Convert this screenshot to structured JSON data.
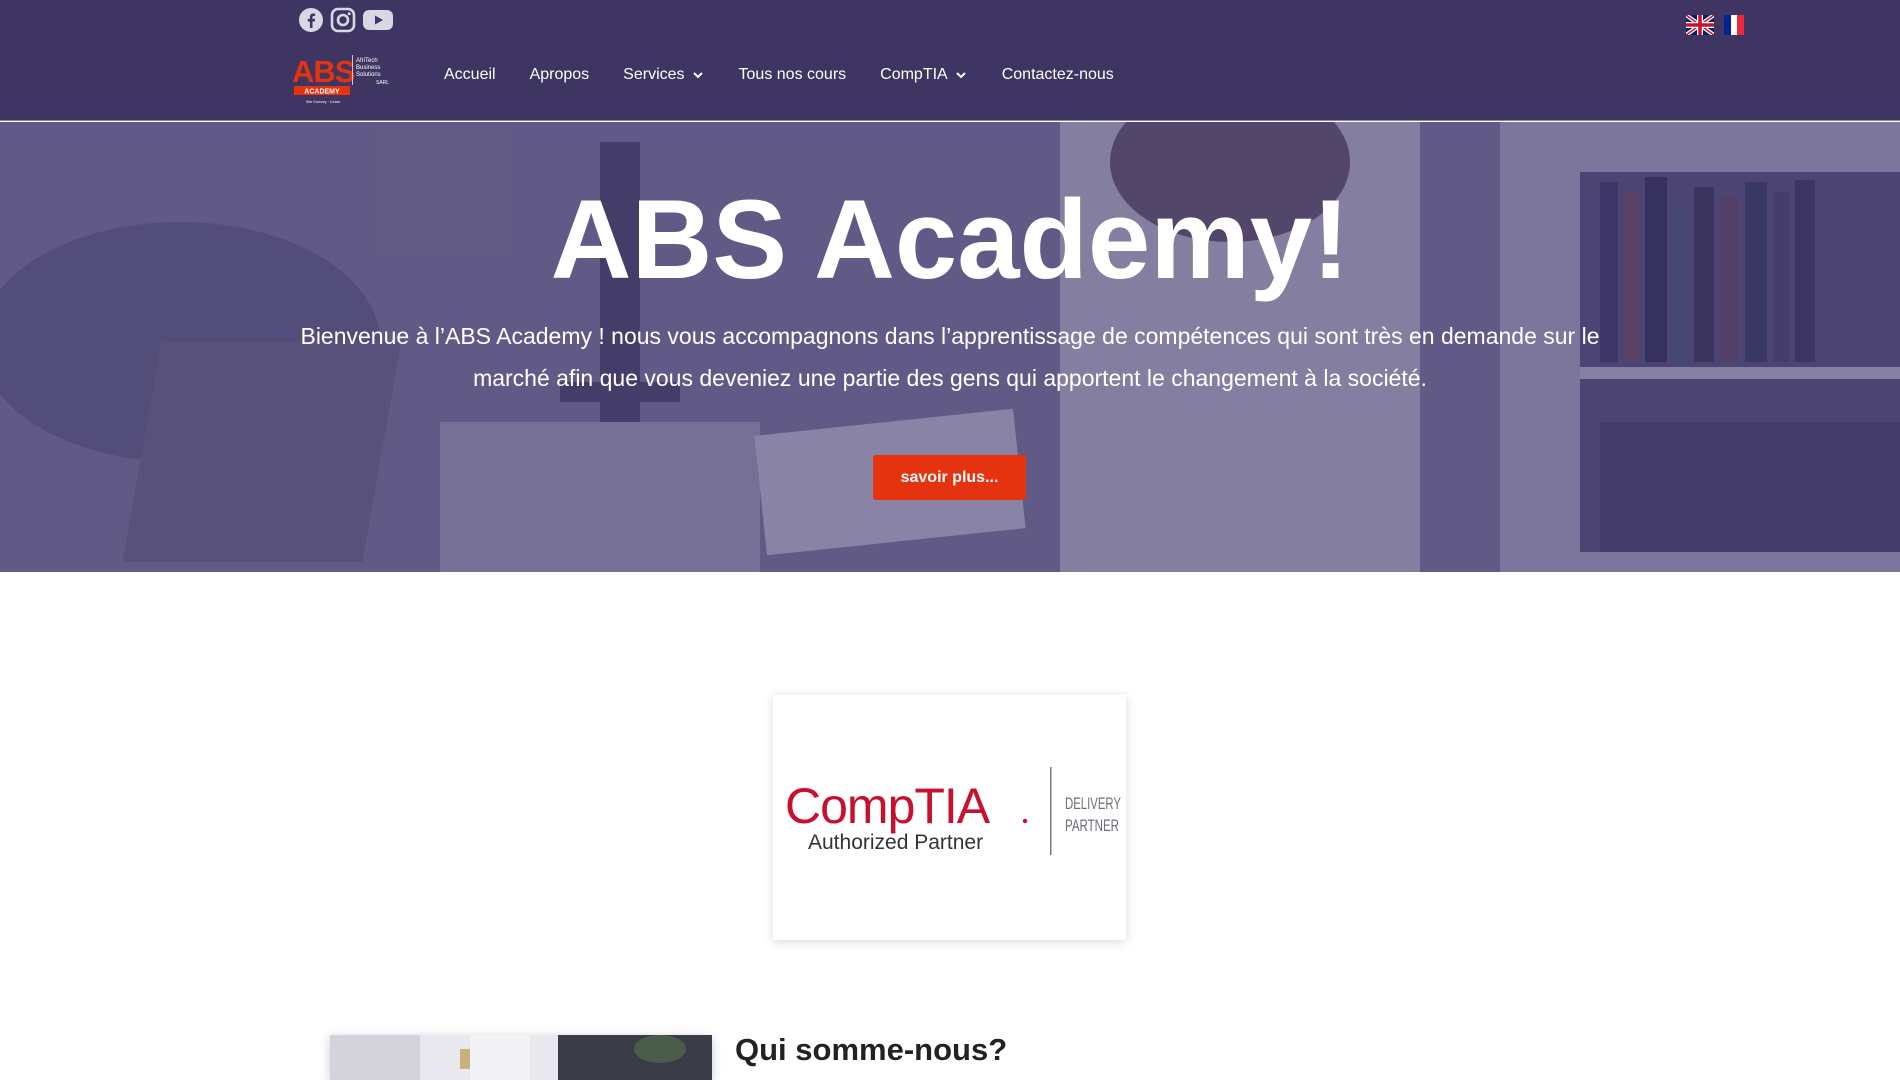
{
  "header": {
    "social": [
      {
        "name": "facebook-icon"
      },
      {
        "name": "instagram-icon"
      },
      {
        "name": "youtube-icon"
      }
    ],
    "logo": {
      "brand": "ABS",
      "sub": "ACADEMY",
      "tagline": "AfriTech Business Solutions SARL"
    },
    "nav": [
      {
        "label": "Accueil",
        "dropdown": false
      },
      {
        "label": "Apropos",
        "dropdown": false
      },
      {
        "label": "Services",
        "dropdown": true
      },
      {
        "label": "Tous nos cours",
        "dropdown": false
      },
      {
        "label": "CompTIA",
        "dropdown": true
      },
      {
        "label": "Contactez-nous",
        "dropdown": false
      }
    ],
    "languages": [
      "English",
      "Français"
    ]
  },
  "hero": {
    "title": "ABS Academy!",
    "text": "Bienvenue à l’ABS Academy ! nous vous accompagnons dans l’apprentissage de compétences qui sont très en demande sur le marché afin que vous deveniez une partie des gens qui apportent le changement à la société.",
    "button": "savoir plus..."
  },
  "partner": {
    "brand": "CompTIA",
    "line1": "Authorized Partner",
    "line2": "DELIVERY",
    "line3": "PARTNER"
  },
  "about": {
    "title": "Qui somme-nous?"
  },
  "colors": {
    "header_bg": "#3f3562",
    "accent": "#e5320f",
    "comptia_red": "#c8102e"
  }
}
